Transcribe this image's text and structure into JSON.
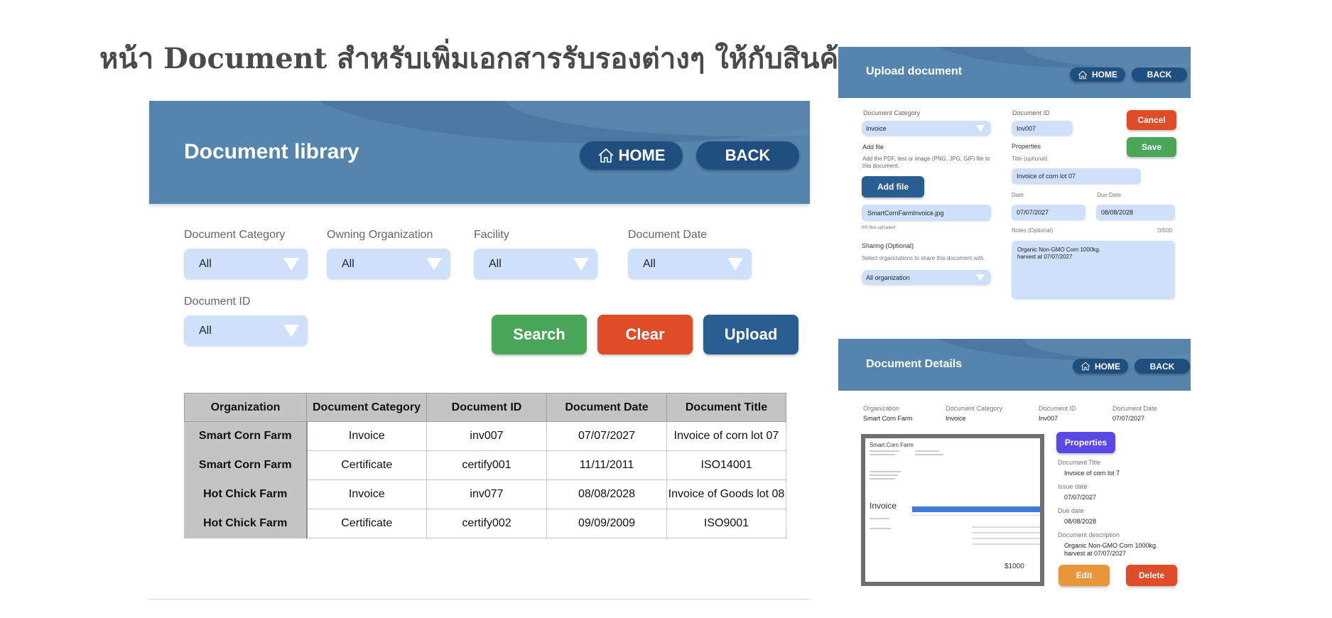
{
  "page_title": "หน้า Document สำหรับเพิ่มเอกสารรับรองต่างๆ ให้กับสินค้า",
  "library": {
    "title": "Document library",
    "home_label": "HOME",
    "back_label": "BACK",
    "filters": {
      "category": {
        "label": "Document Category",
        "value": "All"
      },
      "organization": {
        "label": "Owning Organization",
        "value": "All"
      },
      "facility": {
        "label": "Facility",
        "value": "All"
      },
      "date": {
        "label": "Document Date",
        "value": "All"
      },
      "doc_id": {
        "label": "Document ID",
        "value": "All"
      }
    },
    "search_label": "Search",
    "clear_label": "Clear",
    "upload_label": "Upload",
    "table": {
      "headers": [
        "Organization",
        "Document Category",
        "Document ID",
        "Document Date",
        "Document Title"
      ],
      "rows": [
        [
          "Smart Corn Farm",
          "Invoice",
          "inv007",
          "07/07/2027",
          "Invoice of corn lot 07"
        ],
        [
          "Smart Corn Farm",
          "Certificate",
          "certify001",
          "11/11/2011",
          "ISO14001"
        ],
        [
          "Hot Chick Farm",
          "Invoice",
          "inv077",
          "08/08/2028",
          "Invoice of Goods lot 08"
        ],
        [
          "Hot Chick Farm",
          "Certificate",
          "certify002",
          "09/09/2009",
          "ISO9001"
        ]
      ]
    }
  },
  "upload": {
    "title": "Upload document",
    "home_label": "HOME",
    "back_label": "BACK",
    "category_label": "Document Category",
    "category_value": "Invoice",
    "doc_id_label": "Document ID",
    "doc_id_value": "Inv007",
    "cancel_label": "Cancel",
    "save_label": "Save",
    "add_file_heading": "Add file",
    "add_file_hint": "Add the PDF, test or image (PNG, JPG, GIF) file to this document.",
    "add_file_button": "Add file",
    "file_name": "SmartCornFarmInvoice.jpg",
    "files_uploaded": "0/0 files uploaded",
    "properties_heading": "Properties",
    "title_label": "Title (optional)",
    "title_value": "Invoice of corn lot 07",
    "date_label": "Date",
    "date_value": "07/07/2027",
    "due_date_label": "Due Date",
    "due_date_value": "08/08/2028",
    "notes_label": "Notes (Optional)",
    "notes_count": "0/500",
    "notes_value": "Organic Non-GMO Corn 1000kg.\nharvest at 07/07/2027",
    "sharing_label": "Sharing (Optional)",
    "sharing_hint": "Select organizations to share this document with.",
    "sharing_value": "All organization"
  },
  "details": {
    "title": "Document Details",
    "home_label": "HOME",
    "back_label": "BACK",
    "meta": {
      "organization_label": "Organization",
      "organization_value": "Smart Corn Farm",
      "category_label": "Document Category",
      "category_value": "Invoice",
      "doc_id_label": "Document ID",
      "doc_id_value": "Inv007",
      "date_label": "Document Date",
      "date_value": "07/07/2027"
    },
    "properties_button": "Properties",
    "doc_title_label": "Document Title",
    "doc_title_value": "Invoice of corn lot 7",
    "issue_date_label": "Issue date",
    "issue_date_value": "07/07/2027",
    "due_date_label": "Due date",
    "due_date_value": "08/08/2028",
    "description_label": "Document description",
    "description_value": "Organic Non-GMO Corn 1000kg.\nharvest at 07/07/2027",
    "edit_label": "Edit",
    "delete_label": "Delete",
    "preview": {
      "company": "Smart Corn Farm",
      "heading": "Invoice",
      "total": "$1000"
    }
  },
  "colors": {
    "header_blue": "#5584ac",
    "navy": "#1f4f7f",
    "field_blue": "#cfe0fb",
    "green": "#4aa75a",
    "red": "#e04c28",
    "orange": "#e8963a",
    "purple": "#5a48e8"
  }
}
